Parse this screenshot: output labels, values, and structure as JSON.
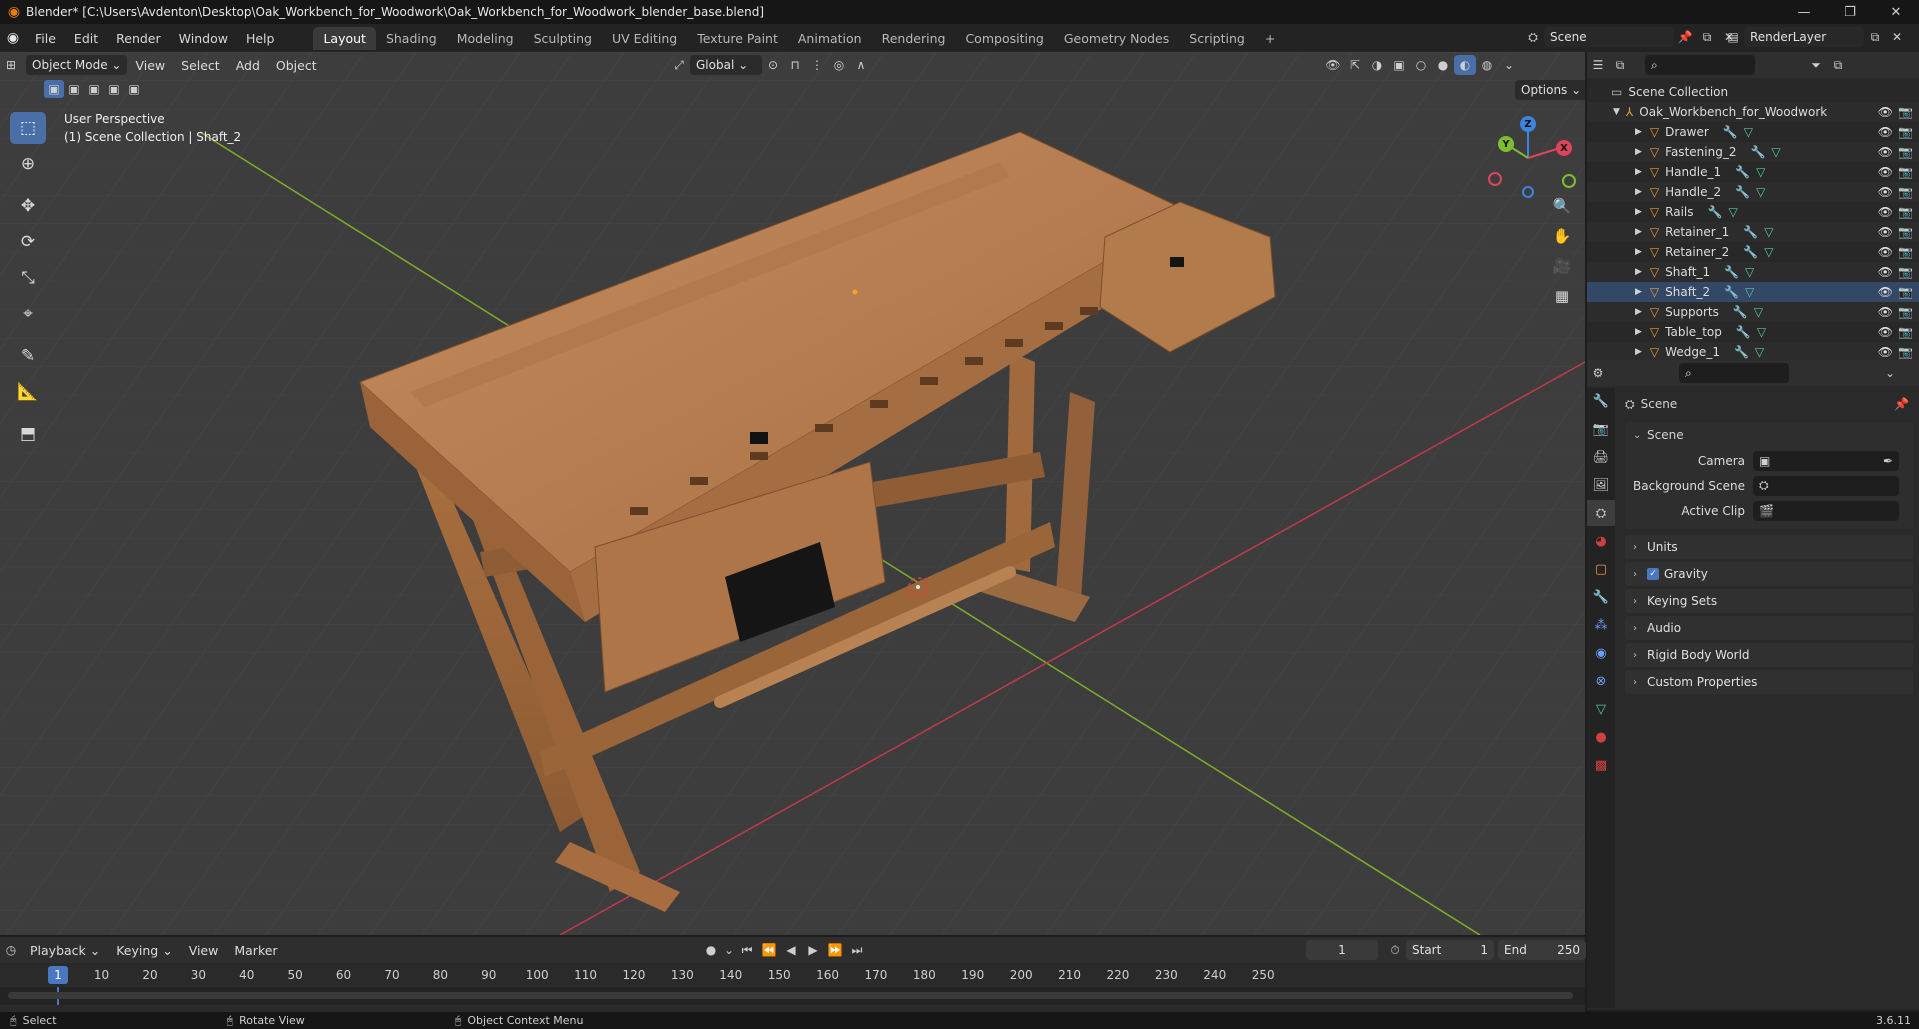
{
  "window": {
    "title": "Blender* [C:\\Users\\Avdenton\\Desktop\\Oak_Workbench_for_Woodwork\\Oak_Workbench_for_Woodwork_blender_base.blend]",
    "controls": [
      "minimize-icon",
      "maximize-icon",
      "close-icon"
    ]
  },
  "menubar": {
    "items": [
      "File",
      "Edit",
      "Render",
      "Window",
      "Help"
    ],
    "workspaces": [
      "Layout",
      "Shading",
      "Modeling",
      "Sculpting",
      "UV Editing",
      "Texture Paint",
      "Animation",
      "Rendering",
      "Compositing",
      "Geometry Nodes",
      "Scripting"
    ],
    "active_workspace": "Layout",
    "add_tab": "+",
    "scene_name": "Scene",
    "view_layer": "RenderLayer"
  },
  "viewport": {
    "mode": "Object Mode",
    "menus": [
      "View",
      "Select",
      "Add",
      "Object"
    ],
    "transform_orientation": "Global",
    "options_label": "Options",
    "perspective_label": "User Perspective",
    "collection_info": "(1) Scene Collection | Shaft_2",
    "gizmo_axes": [
      "X",
      "Y",
      "Z"
    ],
    "colors": {
      "x_axis": "#e0445b",
      "y_axis": "#7fbd2e",
      "z_axis": "#3b84e0",
      "background": "#3d3d3d",
      "wood": "#b57a4f"
    }
  },
  "outliner": {
    "root": "Scene Collection",
    "collection": "Oak_Workbench_for_Woodwork",
    "objects": [
      "Drawer",
      "Fastening_2",
      "Handle_1",
      "Handle_2",
      "Rails",
      "Retainer_1",
      "Retainer_2",
      "Shaft_1",
      "Shaft_2",
      "Supports",
      "Table_top",
      "Wedge_1"
    ],
    "selected": "Shaft_2"
  },
  "properties": {
    "context_title": "Scene",
    "section_scene": "Scene",
    "fields": [
      {
        "label": "Camera",
        "value": ""
      },
      {
        "label": "Background Scene",
        "value": ""
      },
      {
        "label": "Active Clip",
        "value": ""
      }
    ],
    "panels": [
      "Units",
      "Gravity",
      "Keying Sets",
      "Audio",
      "Rigid Body World",
      "Custom Properties"
    ],
    "gravity_checked": true
  },
  "timeline": {
    "menus": [
      "Playback",
      "Keying",
      "View",
      "Marker"
    ],
    "current_frame": "1",
    "start_label": "Start",
    "start": "1",
    "end_label": "End",
    "end": "250",
    "ticks": [
      "10",
      "20",
      "30",
      "40",
      "50",
      "60",
      "70",
      "80",
      "90",
      "100",
      "110",
      "120",
      "130",
      "140",
      "150",
      "160",
      "170",
      "180",
      "190",
      "200",
      "210",
      "220",
      "230",
      "240",
      "250"
    ]
  },
  "statusbar": {
    "hints": [
      "Select",
      "Rotate View",
      "Object Context Menu"
    ],
    "version": "3.6.11"
  }
}
